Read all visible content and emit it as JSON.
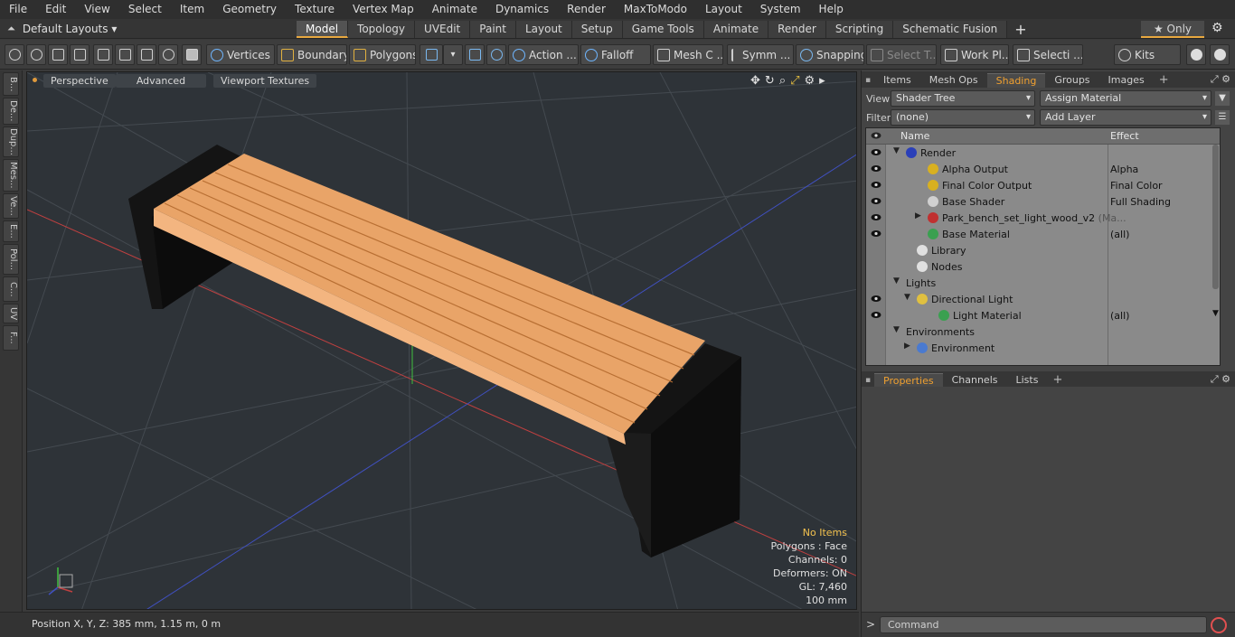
{
  "menu": [
    "File",
    "Edit",
    "View",
    "Select",
    "Item",
    "Geometry",
    "Texture",
    "Vertex Map",
    "Animate",
    "Dynamics",
    "Render",
    "MaxToModo",
    "Layout",
    "System",
    "Help"
  ],
  "layout_selector": "Default Layouts ▾",
  "layout_tabs": [
    {
      "label": "Model",
      "active": true
    },
    {
      "label": "Topology",
      "active": false
    },
    {
      "label": "UVEdit",
      "active": false
    },
    {
      "label": "Paint",
      "active": false
    },
    {
      "label": "Layout",
      "active": false
    },
    {
      "label": "Setup",
      "active": false
    },
    {
      "label": "Game Tools",
      "active": false
    },
    {
      "label": "Animate",
      "active": false
    },
    {
      "label": "Render",
      "active": false
    },
    {
      "label": "Scripting",
      "active": false
    },
    {
      "label": "Schematic Fusion",
      "active": false
    }
  ],
  "only_label": "★  Only",
  "toolbar": {
    "vertices": "Vertices",
    "boundary": "Boundary",
    "polygons": "Polygons",
    "action": "Action ...",
    "falloff": "Falloff",
    "mesh": "Mesh C ...",
    "symm": "Symm ...",
    "snapping": "Snapping",
    "select_t": "Select T...",
    "work_pl": "Work Pl...",
    "selecti": "Selecti ...",
    "kits": "Kits"
  },
  "left_tabs": [
    "B...",
    "De...",
    "Dup...",
    "Mes...",
    "Ve...",
    "E...",
    "Pol...",
    "C...",
    "UV",
    "F..."
  ],
  "viewport": {
    "perspective": "Perspective",
    "advanced": "Advanced",
    "viewport_textures": "Viewport Textures",
    "info": {
      "items": "No Items",
      "polygons": "Polygons : Face",
      "channels": "Channels: 0",
      "deformers": "Deformers: ON",
      "gl": "GL: 7,460",
      "scale": "100 mm"
    }
  },
  "status": {
    "position": "Position X, Y, Z:   385 mm, 1.15 m, 0 m"
  },
  "right_tabs": [
    "Items",
    "Mesh Ops",
    "Shading",
    "Groups",
    "Images"
  ],
  "right_active_tab": "Shading",
  "view_label": "View",
  "view_value": "Shader Tree",
  "assign_material": "Assign Material",
  "filter_label": "Filter",
  "filter_value": "(none)",
  "add_layer": "Add Layer",
  "tree_header": {
    "name": "Name",
    "effect": "Effect"
  },
  "tree_rows": [
    {
      "label": "Render",
      "effect": "",
      "eye": true,
      "indent": 0,
      "twisty": "▼",
      "icon": "render-sphere-icon",
      "icolor": "#2a3fb8",
      "arrow": false
    },
    {
      "label": "Alpha Output",
      "effect": "Alpha",
      "eye": true,
      "indent": 2,
      "twisty": "",
      "icon": "output-icon",
      "icolor": "#d8b020",
      "arrow": true
    },
    {
      "label": "Final Color Output",
      "effect": "Final Color",
      "eye": true,
      "indent": 2,
      "twisty": "",
      "icon": "output-icon",
      "icolor": "#d8b020",
      "arrow": true
    },
    {
      "label": "Base Shader",
      "effect": "Full Shading",
      "eye": true,
      "indent": 2,
      "twisty": "",
      "icon": "shader-sphere-icon",
      "icolor": "#d0d0d0",
      "arrow": true
    },
    {
      "label": "Park_bench_set_light_wood_v2",
      "suffix": " (Ma...",
      "effect": "",
      "eye": true,
      "indent": 2,
      "twisty": "▶",
      "icon": "material-group-icon",
      "icolor": "#c03030",
      "arrow": true
    },
    {
      "label": "Base Material",
      "effect": "(all)",
      "eye": true,
      "indent": 2,
      "twisty": "",
      "icon": "material-sphere-icon",
      "icolor": "#3aa050",
      "arrow": true
    },
    {
      "label": "Library",
      "effect": "",
      "eye": false,
      "indent": 1,
      "twisty": "",
      "icon": "library-icon",
      "icolor": "#e0e0e0",
      "arrow": false
    },
    {
      "label": "Nodes",
      "effect": "",
      "eye": false,
      "indent": 1,
      "twisty": "",
      "icon": "nodes-icon",
      "icolor": "#e0e0e0",
      "arrow": false
    },
    {
      "label": "Lights",
      "effect": "",
      "eye": false,
      "indent": 0,
      "twisty": "▼",
      "icon": "",
      "icolor": "",
      "arrow": false
    },
    {
      "label": "Directional Light",
      "effect": "",
      "eye": true,
      "indent": 1,
      "twisty": "▼",
      "icon": "light-icon",
      "icolor": "#e0c040",
      "arrow": false
    },
    {
      "label": "Light Material",
      "effect": "(all)",
      "eye": true,
      "indent": 3,
      "twisty": "",
      "icon": "material-sphere-icon",
      "icolor": "#3aa050",
      "arrow": true
    },
    {
      "label": "Environments",
      "effect": "",
      "eye": false,
      "indent": 0,
      "twisty": "▼",
      "icon": "",
      "icolor": "",
      "arrow": false
    },
    {
      "label": "Environment",
      "effect": "",
      "eye": false,
      "indent": 1,
      "twisty": "▶",
      "icon": "environment-icon",
      "icolor": "#4a7ad0",
      "arrow": false
    }
  ],
  "props_tabs": [
    "Properties",
    "Channels",
    "Lists"
  ],
  "props_active_tab": "Properties",
  "command_placeholder": "Command",
  "command_prompt": ">"
}
